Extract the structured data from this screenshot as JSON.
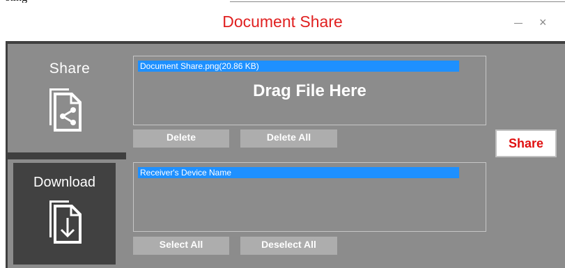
{
  "window": {
    "title": "Document Share",
    "minimize_label": "",
    "close_label": "×"
  },
  "partial_top_text": "sting",
  "tabs": [
    {
      "label": "Share",
      "icon": "share-document-icon"
    },
    {
      "label": "Download",
      "icon": "download-document-icon"
    }
  ],
  "file_panel": {
    "selected_file": "Document Share.png(20.86 KB)",
    "drop_hint": "Drag File Here"
  },
  "file_buttons": {
    "delete": "Delete",
    "delete_all": "Delete All"
  },
  "device_panel": {
    "selected_device": "Receiver's Device Name"
  },
  "device_buttons": {
    "select_all": "Select All",
    "deselect_all": "Deselect All"
  },
  "share_button": "Share",
  "colors": {
    "title": "#e02020",
    "selection": "#1e90ff",
    "background": "#8c8c8c",
    "dark": "#414141",
    "share_text": "#e01010"
  }
}
